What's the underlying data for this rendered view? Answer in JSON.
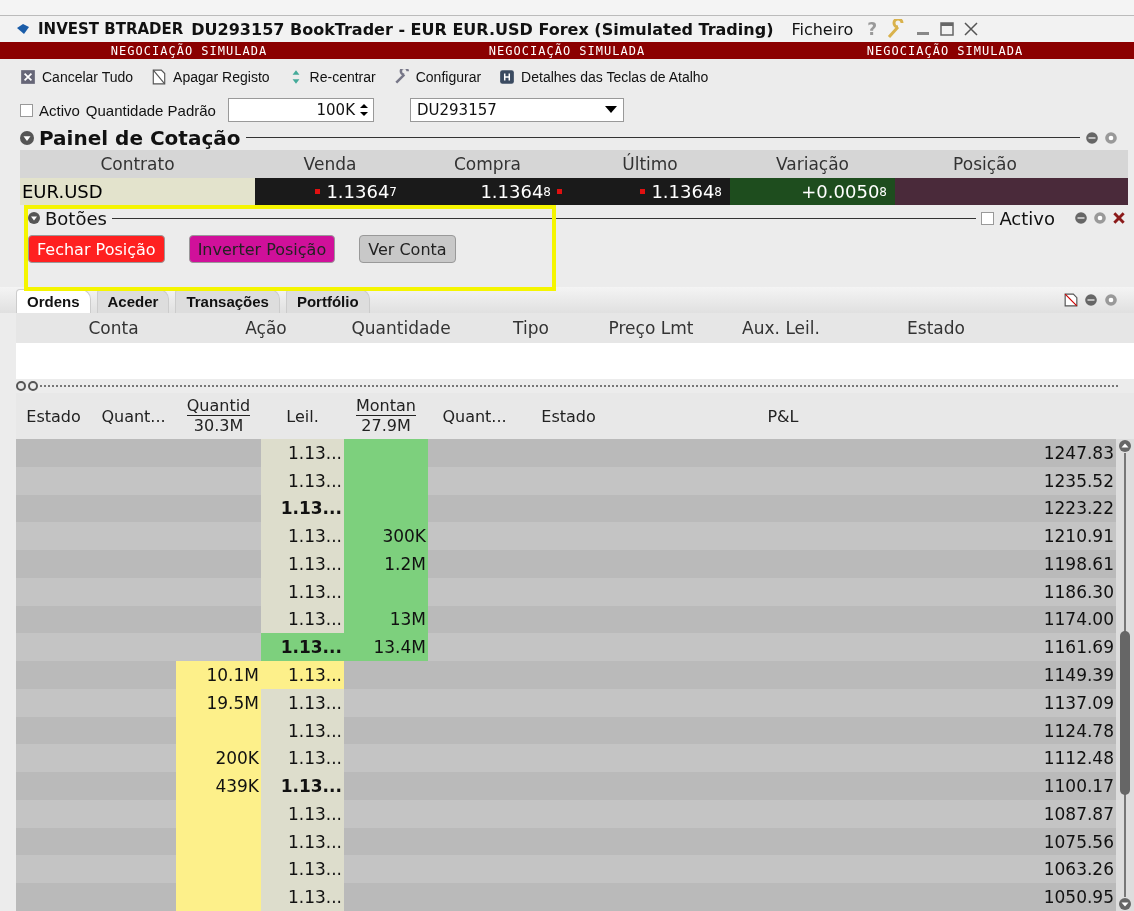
{
  "window": {
    "app": "INVEST BTRADER",
    "title": "DU293157 BookTrader - EUR EUR.USD Forex (Simulated Trading)",
    "menu": "Ficheiro",
    "help": "?"
  },
  "banner": [
    "NEGOCIAÇÃO SIMULADA",
    "NEGOCIAÇÃO SIMULADA",
    "NEGOCIAÇÃO SIMULADA"
  ],
  "toolbar": [
    {
      "label": "Cancelar Tudo",
      "kind": "cancel"
    },
    {
      "label": "Apagar Registo",
      "kind": "erase"
    },
    {
      "label": "Re-centrar",
      "kind": "center"
    },
    {
      "label": "Configurar",
      "kind": "configure"
    },
    {
      "label": "Detalhes das Teclas de Atalho",
      "kind": "hotkeys"
    }
  ],
  "settings": {
    "active_label": "Activo",
    "active": false,
    "quantity_label": "Quantidade Padrão",
    "quantity": "100K",
    "account": "DU293157"
  },
  "quote_panel": {
    "title": "Painel de Cotação",
    "columns": [
      "Contrato",
      "Venda",
      "Compra",
      "Último",
      "Variação",
      "Posição"
    ],
    "row": {
      "contract": "EUR.USD",
      "bid": "1.1364",
      "bid_sup": "7",
      "ask": "1.1364",
      "ask_sup": "8",
      "last": "1.1364",
      "last_sup": "8",
      "change": "+0.0050",
      "change_sup": "8"
    }
  },
  "buttons_panel": {
    "title": "Botões",
    "active_label": "Activo",
    "active": false,
    "buttons": [
      {
        "label": "Fechar Posição",
        "color": "#ff2020"
      },
      {
        "label": "Inverter Posição",
        "color": "#d0109a"
      },
      {
        "label": "Ver Conta",
        "color": "#c8c8c8"
      }
    ]
  },
  "tabs": [
    {
      "label": "Ordens",
      "selected": true
    },
    {
      "label": "Aceder",
      "selected": false
    },
    {
      "label": "Transações",
      "selected": false
    },
    {
      "label": "Portfólio",
      "selected": false
    }
  ],
  "orders": {
    "columns": [
      "Conta",
      "Ação",
      "Quantidade",
      "Tipo",
      "Preço Lmt",
      "Aux. Leil.",
      "Estado"
    ]
  },
  "book": {
    "columns": [
      {
        "label": "Estado"
      },
      {
        "label": "Quant..."
      },
      {
        "label": "Quantid",
        "total": "30.3M"
      },
      {
        "label": "Leil."
      },
      {
        "label": "Montan",
        "total": "27.9M"
      },
      {
        "label": "Quant..."
      },
      {
        "label": "Estado"
      },
      {
        "label": "P&L"
      }
    ],
    "rows": [
      {
        "ask": true,
        "price": "1.13...",
        "bold": false,
        "best": false,
        "size": "",
        "pnl": "1247.83"
      },
      {
        "ask": true,
        "price": "1.13...",
        "bold": false,
        "best": false,
        "size": "",
        "pnl": "1235.52"
      },
      {
        "ask": true,
        "price": "1.13...",
        "bold": true,
        "best": false,
        "size": "",
        "pnl": "1223.22"
      },
      {
        "ask": true,
        "price": "1.13...",
        "bold": false,
        "best": false,
        "size": "300K",
        "pnl": "1210.91"
      },
      {
        "ask": true,
        "price": "1.13...",
        "bold": false,
        "best": false,
        "size": "1.2M",
        "pnl": "1198.61"
      },
      {
        "ask": true,
        "price": "1.13...",
        "bold": false,
        "best": false,
        "size": "",
        "pnl": "1186.30"
      },
      {
        "ask": true,
        "price": "1.13...",
        "bold": false,
        "best": false,
        "size": "13M",
        "pnl": "1174.00"
      },
      {
        "ask": true,
        "price": "1.13...",
        "bold": true,
        "best": true,
        "size": "13.4M",
        "pnl": "1161.69"
      },
      {
        "ask": false,
        "price": "1.13...",
        "bold": false,
        "best": true,
        "size": "10.1M",
        "pnl": "1149.39"
      },
      {
        "ask": false,
        "price": "1.13...",
        "bold": false,
        "best": false,
        "size": "19.5M",
        "pnl": "1137.09"
      },
      {
        "ask": false,
        "price": "1.13...",
        "bold": false,
        "best": false,
        "size": "",
        "pnl": "1124.78"
      },
      {
        "ask": false,
        "price": "1.13...",
        "bold": false,
        "best": false,
        "size": "200K",
        "pnl": "1112.48"
      },
      {
        "ask": false,
        "price": "1.13...",
        "bold": true,
        "best": false,
        "size": "439K",
        "pnl": "1100.17"
      },
      {
        "ask": false,
        "price": "1.13...",
        "bold": false,
        "best": false,
        "size": "",
        "pnl": "1087.87"
      },
      {
        "ask": false,
        "price": "1.13...",
        "bold": false,
        "best": false,
        "size": "",
        "pnl": "1075.56"
      },
      {
        "ask": false,
        "price": "1.13...",
        "bold": false,
        "best": false,
        "size": "",
        "pnl": "1063.26"
      },
      {
        "ask": false,
        "price": "1.13...",
        "bold": false,
        "best": false,
        "size": "",
        "pnl": "1050.95"
      }
    ]
  }
}
